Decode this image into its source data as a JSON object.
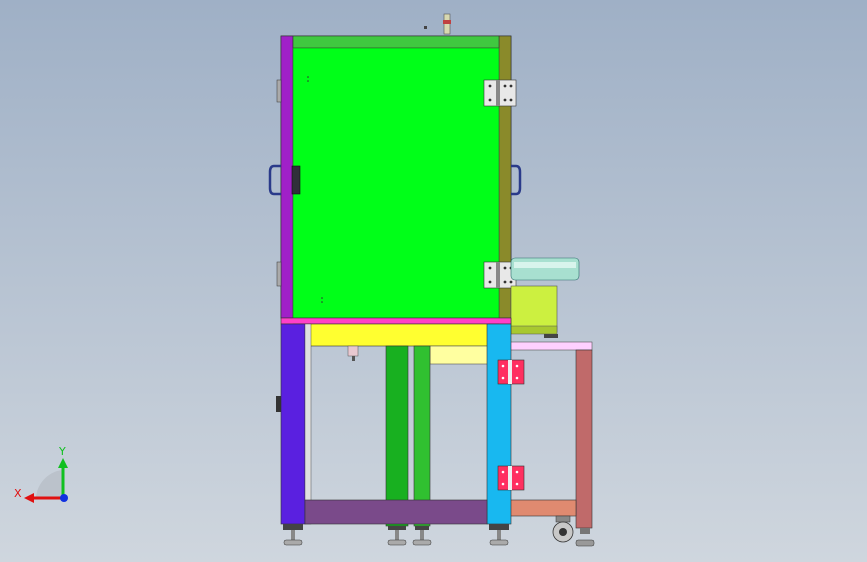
{
  "viewport": {
    "background_top": "#9fb0c6",
    "background_bottom": "#cfd6de"
  },
  "triad": {
    "x_label": "X",
    "y_label": "Y",
    "x_color": "#e01010",
    "y_color": "#10c020",
    "z_color": "#1030e0"
  },
  "parts": {
    "cabinet_door_color": "#00ff18",
    "cabinet_frame_left_color": "#a020c8",
    "cabinet_frame_right_color": "#8a8a2a",
    "stand_leg_left_color": "#5a20e0",
    "stand_leg_right_color": "#18b8f0",
    "stand_top_beam_color": "#ffff30",
    "stand_bottom_beam_color": "#7a4a8a",
    "center_leg_color": "#18b020",
    "side_table_color": "#c06a6a",
    "feeder_bowl_color": "#a8e0d0",
    "feeder_base_color": "#ccf040"
  }
}
